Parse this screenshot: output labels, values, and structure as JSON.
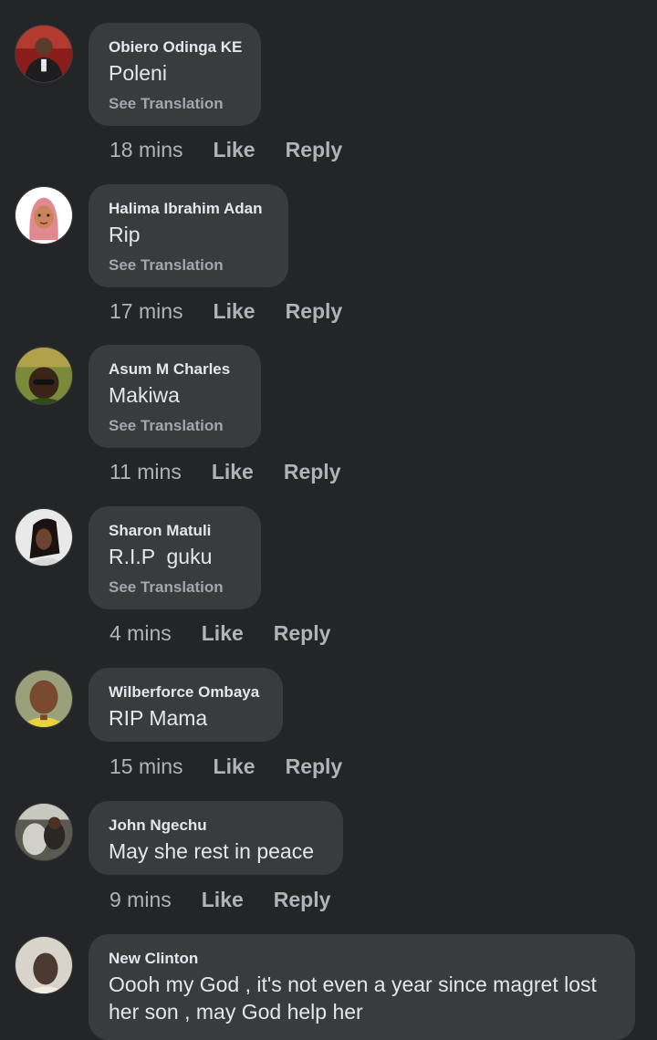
{
  "comments": [
    {
      "author": "Obiero Odinga KE",
      "text": "Poleni",
      "translation": "See Translation",
      "time": "18 mins",
      "like": "Like",
      "reply": "Reply"
    },
    {
      "author": "Halima Ibrahim Adan",
      "text": "Rip",
      "translation": "See Translation",
      "time": "17 mins",
      "like": "Like",
      "reply": "Reply"
    },
    {
      "author": "Asum M Charles",
      "text": "Makiwa",
      "translation": "See Translation",
      "time": "11 mins",
      "like": "Like",
      "reply": "Reply"
    },
    {
      "author": "Sharon Matuli",
      "text": "R.I.P  guku",
      "translation": "See Translation",
      "time": "4 mins",
      "like": "Like",
      "reply": "Reply"
    },
    {
      "author": "Wilberforce Ombaya",
      "text": "RIP Mama",
      "time": "15 mins",
      "like": "Like",
      "reply": "Reply"
    },
    {
      "author": "John Ngechu",
      "text": "May she rest in peace",
      "time": "9 mins",
      "like": "Like",
      "reply": "Reply"
    },
    {
      "author": "New Clinton",
      "text": "Oooh my God , it's not even a year since magret lost her son , may God help her"
    }
  ]
}
